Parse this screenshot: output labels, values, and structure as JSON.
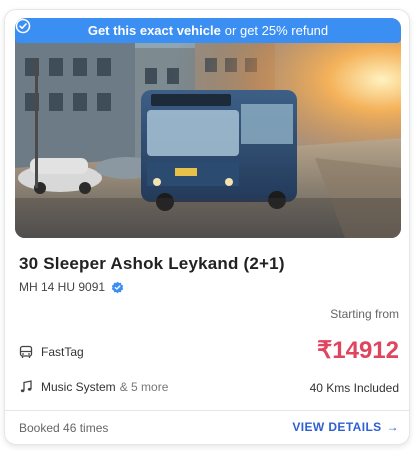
{
  "banner": {
    "highlight": "Get this exact vehicle",
    "rest": "or get 25% refund",
    "color": "#3b8ff3"
  },
  "vehicle": {
    "name": "30 Sleeper Ashok Leykand (2+1)",
    "registration": "MH 14 HU 9091"
  },
  "pricing": {
    "starting_label": "Starting from",
    "price": "₹14912",
    "price_color": "#e0455f"
  },
  "amenities": {
    "fasttag": "FastTag",
    "music": "Music System",
    "more": "& 5 more"
  },
  "distance": "40 Kms Included",
  "footer": {
    "booked": "Booked 46 times",
    "details_label": "VIEW DETAILS",
    "details_icon": "arrow-right-icon"
  }
}
